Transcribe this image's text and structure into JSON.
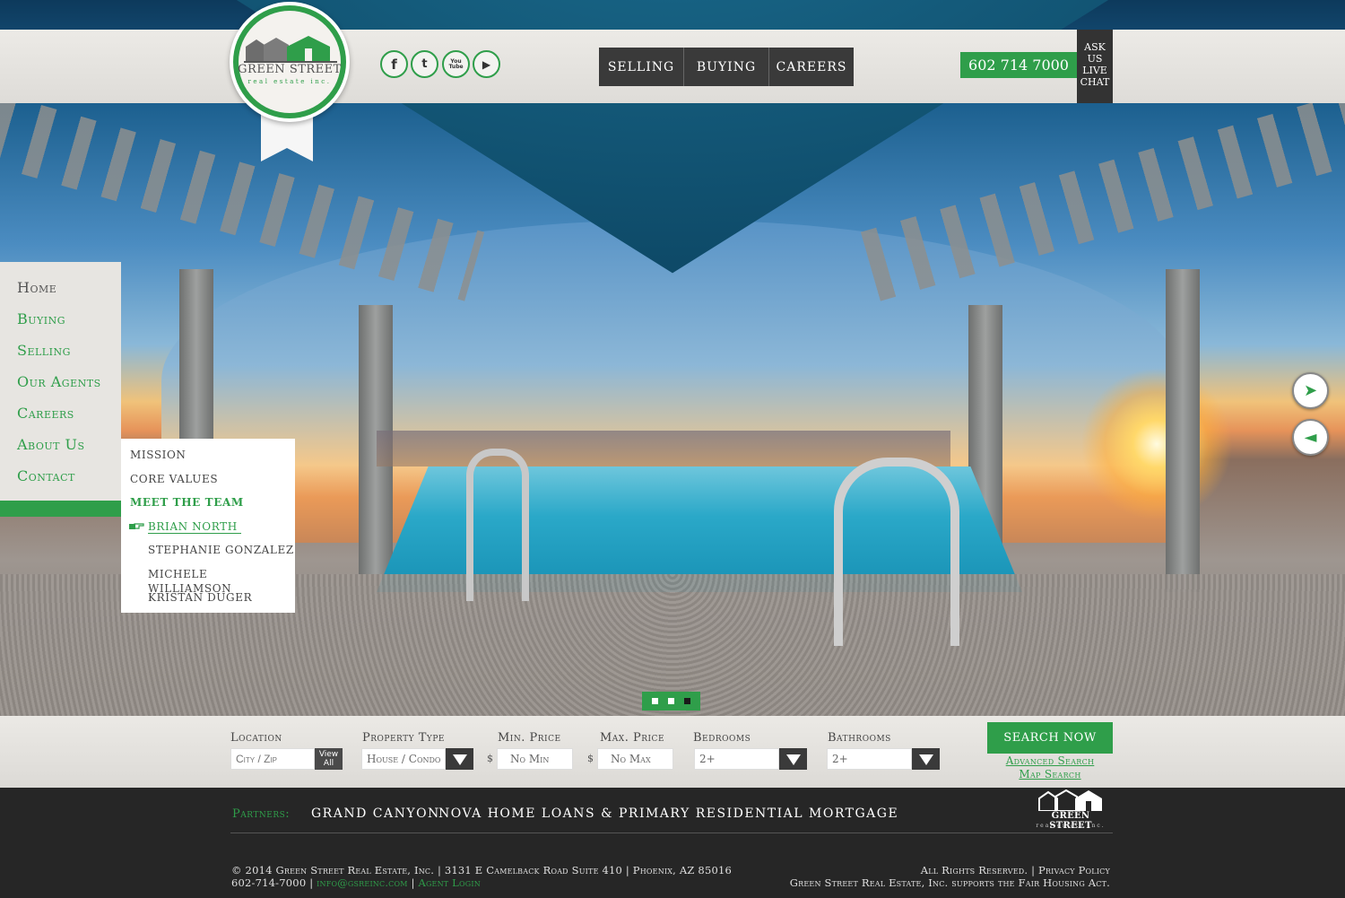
{
  "brand": {
    "name": "GREEN STREET",
    "tagline": "real estate inc.",
    "green": "#2f9e4a",
    "dark": "#3a3a3a"
  },
  "social": [
    {
      "icon": "facebook-icon",
      "glyph": "f"
    },
    {
      "icon": "twitter-icon",
      "glyph": "t"
    },
    {
      "icon": "youtube-icon",
      "glyph": "You Tube"
    },
    {
      "icon": "play-icon",
      "glyph": "▶"
    }
  ],
  "main_nav": [
    "Selling",
    "Buying",
    "Careers"
  ],
  "phone": "602 714 7000",
  "live_chat": [
    "Ask",
    "Us",
    "Live",
    "Chat"
  ],
  "side_nav": [
    "Home",
    "Buying",
    "Selling",
    "Our Agents",
    "Careers",
    "About Us",
    "Contact"
  ],
  "submenu": {
    "items": [
      "Mission",
      "Core Values",
      "Meet the Team"
    ],
    "team": [
      "Brian North",
      "Stephanie Gonzalez",
      "Michele Williamson",
      "Kristan Duger"
    ],
    "active_item": "Meet the Team",
    "current_member": "Brian North"
  },
  "slider": {
    "next_glyph": "➤",
    "prev_glyph": "◄",
    "slide_count": 3,
    "current_slide": 3
  },
  "search": {
    "location_label": "Location",
    "location_placeholder": "City / Zip",
    "view_all": "View All",
    "property_type_label": "Property Type",
    "property_type_value": "House / Condo",
    "min_price_label": "Min. Price",
    "min_price_value": "No Min",
    "max_price_label": "Max. Price",
    "max_price_value": "No Max",
    "currency": "$",
    "bedrooms_label": "Bedrooms",
    "bedrooms_value": "2+",
    "bathrooms_label": "Bathrooms",
    "bathrooms_value": "2+",
    "search_button": "Search Now",
    "advanced_link": "Advanced Search",
    "map_link": "Map Search"
  },
  "footer": {
    "partners_label": "Partners:",
    "partners": [
      "Grand Canyon",
      "Nova Home Loans & Primary Residential Mortgage"
    ],
    "logo_name": "GREEN STREET",
    "logo_tagline": "real estate inc.",
    "copyright": "© 2014 Green Street Real Estate, Inc. | 3131 E Camelback Road Suite 410 | Phoenix, AZ 85016",
    "phone": "602-714-7000 |",
    "email": "info@gsreinc.com",
    "separator": "|",
    "agent_login": "Agent Login",
    "rights": "All Rights Reserved. | Privacy Policy",
    "fair_housing": "Green Street Real Estate, Inc. supports the Fair Housing Act."
  }
}
